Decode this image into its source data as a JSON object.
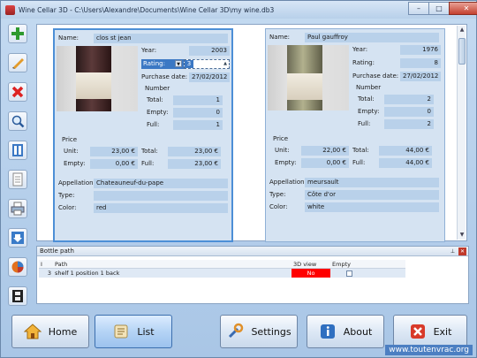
{
  "window": {
    "title": "Wine Cellar 3D - C:\\Users\\Alexandre\\Documents\\Wine Cellar 3D\\my wine.db3",
    "min_glyph": "–",
    "max_glyph": "□",
    "close_glyph": "✕"
  },
  "toolbar_icons": [
    "plus-icon",
    "pencil-icon",
    "delete-x-icon",
    "magnifier-icon",
    "columns-icon",
    "document-icon",
    "printer-icon",
    "download-icon",
    "pie-chart-icon",
    "film-icon"
  ],
  "labels": {
    "name": "Name:",
    "year": "Year:",
    "rating": "Rating:",
    "purchase_date": "Purchase date:",
    "number": "Number",
    "total": "Total:",
    "empty": "Empty:",
    "full": "Full:",
    "price": "Price",
    "unit": "Unit:",
    "appellation": "Appellation:",
    "type": "Type:",
    "color": "Color:"
  },
  "cards": [
    {
      "name": "clos st jean",
      "year": "2003",
      "rating": "3",
      "purchase_date": "27/02/2012",
      "number_total": "1",
      "number_empty": "0",
      "number_full": "1",
      "price_unit": "23,00 €",
      "price_unit_total": "23,00 €",
      "price_empty": "0,00 €",
      "price_full": "23,00 €",
      "appellation": "Chateauneuf-du-pape",
      "type": "",
      "color": "red"
    },
    {
      "name": "Paul gauffroy",
      "year": "1976",
      "rating": "8",
      "purchase_date": "27/02/2012",
      "number_total": "2",
      "number_empty": "0",
      "number_full": "2",
      "price_unit": "22,00 €",
      "price_unit_total": "44,00 €",
      "price_empty": "0,00 €",
      "price_full": "44,00 €",
      "appellation": "meursault",
      "type": "Côte d'or",
      "color": "white"
    }
  ],
  "bottle_path": {
    "title": "Bottle path",
    "pin_glyph": "⊥",
    "close_glyph": "✕",
    "columns": [
      "I",
      "Path",
      "3D view",
      "Empty"
    ],
    "rows": [
      {
        "index": "3",
        "path": "shelf 1 position 1 back",
        "view3d": "No",
        "empty": ""
      }
    ]
  },
  "buttons": {
    "home": "Home",
    "list": "List",
    "settings": "Settings",
    "about": "About",
    "exit": "Exit"
  },
  "watermark": "www.toutenvrac.org",
  "colors": {
    "accent": "#4d8fd6",
    "no_cell": "#ff0000",
    "exit": "#d83a2a"
  }
}
